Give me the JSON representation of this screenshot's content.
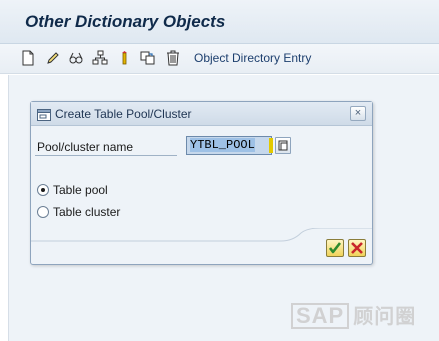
{
  "window": {
    "title": "Other Dictionary Objects"
  },
  "toolbar": {
    "icons": [
      "new-document-icon",
      "edit-pencil-icon",
      "display-glasses-icon",
      "hierarchy-icon",
      "activate-icon",
      "copy-icon",
      "delete-trash-icon"
    ],
    "object_directory_label": "Object Directory Entry"
  },
  "dialog": {
    "title": "Create Table Pool/Cluster",
    "field_label": "Pool/cluster name",
    "field_value": "YTBL_POOL",
    "radio_options": [
      {
        "label": "Table pool",
        "selected": true
      },
      {
        "label": "Table cluster",
        "selected": false
      }
    ],
    "close_label": "×"
  },
  "watermark": {
    "sap": "SAP",
    "cn": "顾问圈"
  },
  "colors": {
    "accent": "#1d3f6e",
    "confirm": "#2e8b2e",
    "cancel": "#c8262a",
    "background": "#eef3f8"
  }
}
